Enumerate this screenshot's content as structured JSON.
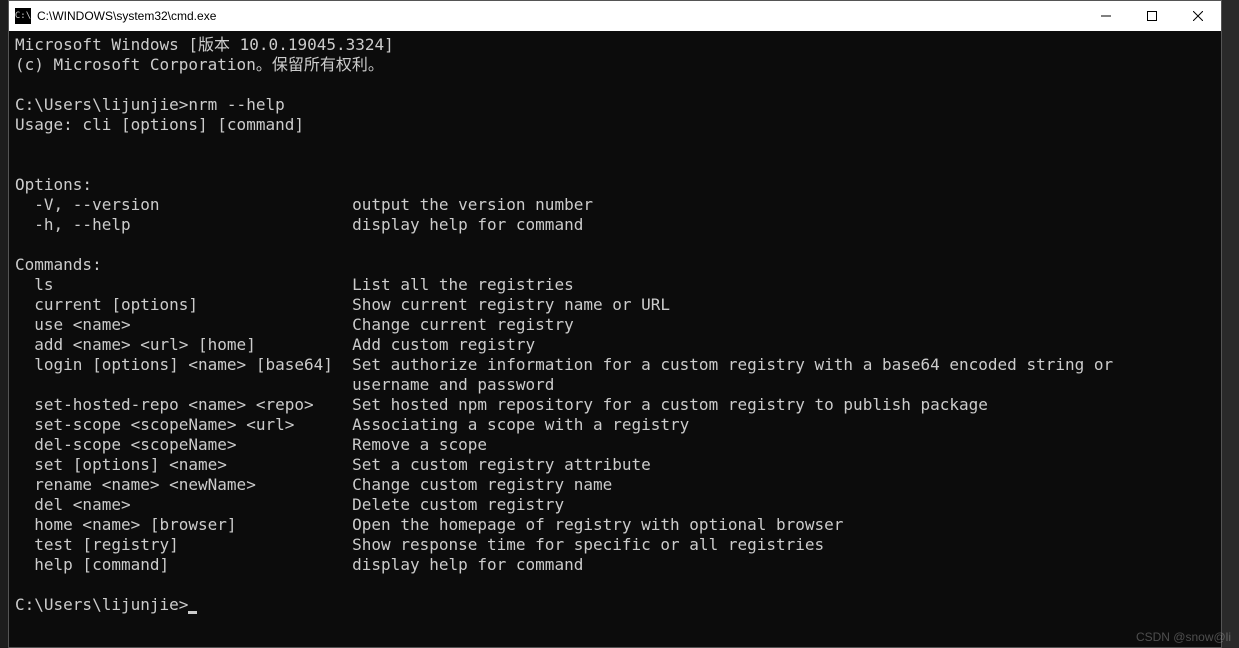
{
  "window": {
    "title": "C:\\WINDOWS\\system32\\cmd.exe"
  },
  "terminal": {
    "header1": "Microsoft Windows [版本 10.0.19045.3324]",
    "header2": "(c) Microsoft Corporation。保留所有权利。",
    "prompt1": "C:\\Users\\lijunjie>",
    "command1": "nrm --help",
    "usage": "Usage: cli [options] [command]",
    "options_header": "Options:",
    "options": [
      {
        "flag": "-V, --version",
        "desc": "output the version number"
      },
      {
        "flag": "-h, --help",
        "desc": "display help for command"
      }
    ],
    "commands_header": "Commands:",
    "commands": [
      {
        "cmd": "ls",
        "desc": "List all the registries"
      },
      {
        "cmd": "current [options]",
        "desc": "Show current registry name or URL"
      },
      {
        "cmd": "use <name>",
        "desc": "Change current registry"
      },
      {
        "cmd": "add <name> <url> [home]",
        "desc": "Add custom registry"
      },
      {
        "cmd": "login [options] <name> [base64]",
        "desc": "Set authorize information for a custom registry with a base64 encoded string or username and password"
      },
      {
        "cmd": "set-hosted-repo <name> <repo>",
        "desc": "Set hosted npm repository for a custom registry to publish package"
      },
      {
        "cmd": "set-scope <scopeName> <url>",
        "desc": "Associating a scope with a registry"
      },
      {
        "cmd": "del-scope <scopeName>",
        "desc": "Remove a scope"
      },
      {
        "cmd": "set [options] <name>",
        "desc": "Set a custom registry attribute"
      },
      {
        "cmd": "rename <name> <newName>",
        "desc": "Change custom registry name"
      },
      {
        "cmd": "del <name>",
        "desc": "Delete custom registry"
      },
      {
        "cmd": "home <name> [browser]",
        "desc": "Open the homepage of registry with optional browser"
      },
      {
        "cmd": "test [registry]",
        "desc": "Show response time for specific or all registries"
      },
      {
        "cmd": "help [command]",
        "desc": "display help for command"
      }
    ],
    "prompt2": "C:\\Users\\lijunjie>"
  },
  "watermark": "CSDN @snow@li"
}
